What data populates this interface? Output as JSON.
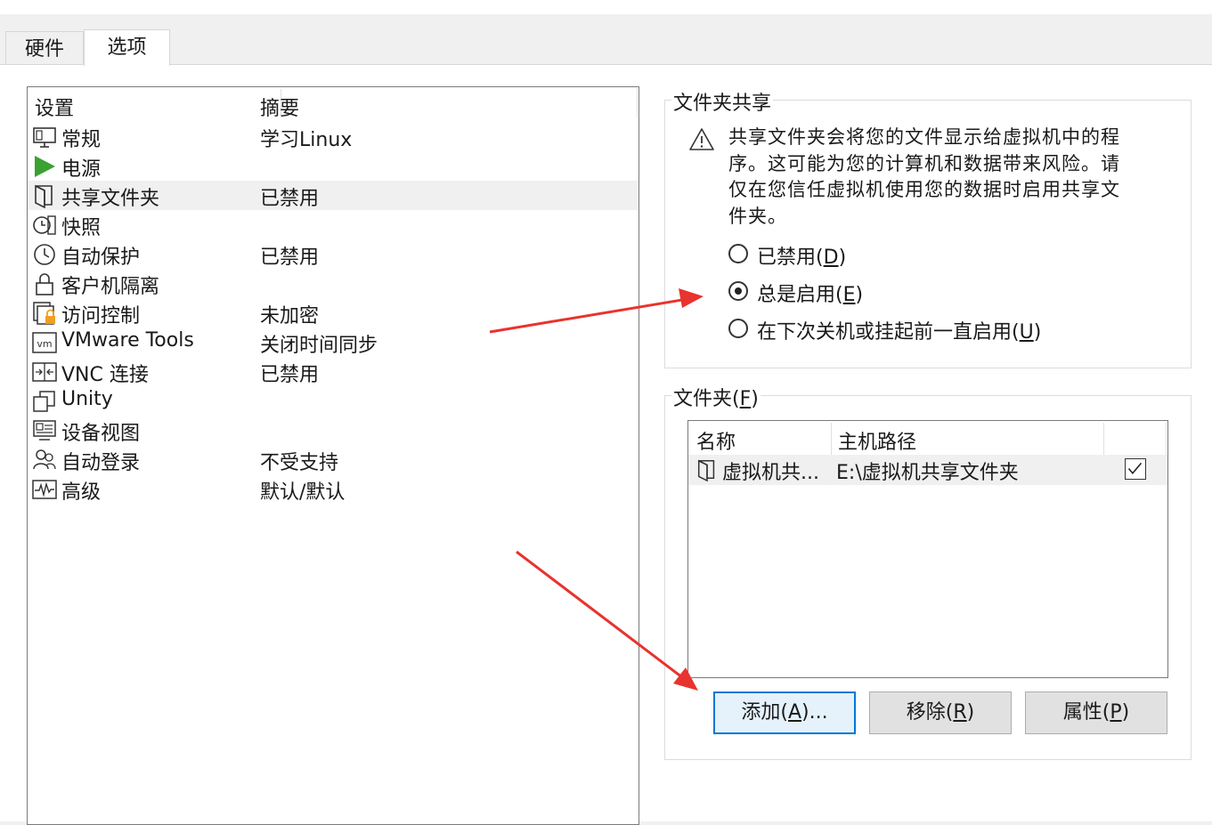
{
  "tabs": [
    {
      "label": "硬件",
      "active": false
    },
    {
      "label": "选项",
      "active": true
    }
  ],
  "settings": {
    "header_setting": "设置",
    "header_summary": "摘要",
    "items": [
      {
        "name": "常规",
        "summary": "学习Linux",
        "icon": "monitor-icon"
      },
      {
        "name": "电源",
        "summary": "",
        "icon": "play-icon"
      },
      {
        "name": "共享文件夹",
        "summary": "已禁用",
        "icon": "shared-folder-icon",
        "selected": true
      },
      {
        "name": "快照",
        "summary": "",
        "icon": "snapshot-icon"
      },
      {
        "name": "自动保护",
        "summary": "已禁用",
        "icon": "clock-icon"
      },
      {
        "name": "客户机隔离",
        "summary": "",
        "icon": "lock-icon"
      },
      {
        "name": "访问控制",
        "summary": "未加密",
        "icon": "access-control-icon"
      },
      {
        "name": "VMware Tools",
        "summary": "关闭时间同步",
        "icon": "vm-icon"
      },
      {
        "name": "VNC 连接",
        "summary": "已禁用",
        "icon": "vnc-icon"
      },
      {
        "name": "Unity",
        "summary": "",
        "icon": "unity-icon"
      },
      {
        "name": "设备视图",
        "summary": "",
        "icon": "device-view-icon"
      },
      {
        "name": "自动登录",
        "summary": "不受支持",
        "icon": "users-icon"
      },
      {
        "name": "高级",
        "summary": "默认/默认",
        "icon": "waveform-icon"
      }
    ]
  },
  "sharing": {
    "title": "文件夹共享",
    "warning": "共享文件夹会将您的文件显示给虚拟机中的程序。这可能为您的计算机和数据带来风险。请仅在您信任虚拟机使用您的数据时启用共享文件夹。",
    "options": [
      {
        "label": "已禁用",
        "key": "D",
        "selected": false
      },
      {
        "label": "总是启用",
        "key": "E",
        "selected": true
      },
      {
        "label": "在下次关机或挂起前一直启用",
        "key": "U",
        "selected": false
      }
    ]
  },
  "folders": {
    "title": "文件夹",
    "title_key": "F",
    "col_name": "名称",
    "col_path": "主机路径",
    "rows": [
      {
        "name": "虚拟机共...",
        "path": "E:\\虚拟机共享文件夹",
        "enabled": true
      }
    ],
    "buttons": {
      "add": {
        "label": "添加",
        "key": "A",
        "suffix": "..."
      },
      "remove": {
        "label": "移除",
        "key": "R",
        "suffix": ""
      },
      "props": {
        "label": "属性",
        "key": "P",
        "suffix": ""
      }
    }
  },
  "colors": {
    "arrow": "#e8332e",
    "accent": "#0078d7",
    "power": "#3aa132",
    "lock": "#f0a020"
  }
}
